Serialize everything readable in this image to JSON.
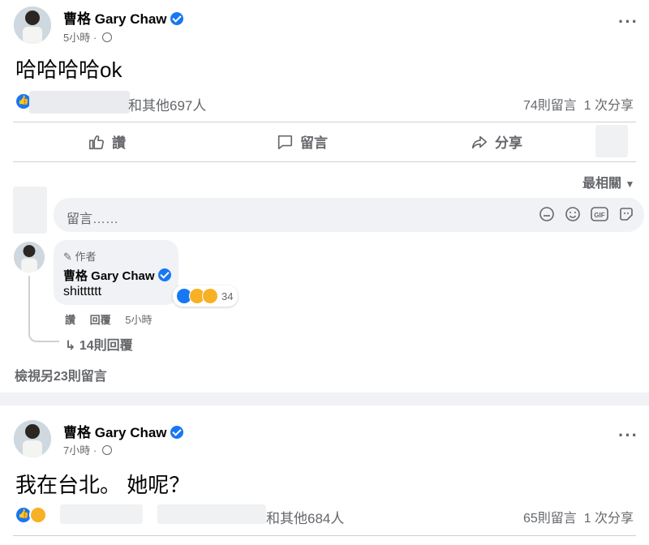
{
  "colors": {
    "accent": "#1877f2",
    "secondary_text": "#65676b",
    "background": "#f0f2f5"
  },
  "posts": [
    {
      "author": "曹格 Gary Chaw",
      "time": "5小時",
      "text": "哈哈哈哈ok",
      "reaction_summary": "和其他697人",
      "comments_count": "74則留言",
      "shares_count": "1 次分享",
      "actions": {
        "like": "讚",
        "comment": "留言",
        "share": "分享"
      },
      "sort_label": "最相關",
      "comment_placeholder": "留言……",
      "comment_icons": [
        "sticker-face-icon",
        "emoji-icon",
        "gif-icon",
        "sticker-icon"
      ],
      "top_comment": {
        "author_tag": "作者",
        "author": "曹格 Gary Chaw",
        "text": "shitttttt",
        "reactions_count": "34",
        "like": "讚",
        "reply": "回覆",
        "time": "5小時",
        "replies": "14則回覆"
      },
      "view_more": "檢視另23則留言"
    },
    {
      "author": "曹格 Gary Chaw",
      "time": "7小時",
      "text": "我在台北。 她呢？",
      "reaction_summary": "和其他684人",
      "comments_count": "65則留言",
      "shares_count": "1 次分享"
    }
  ]
}
